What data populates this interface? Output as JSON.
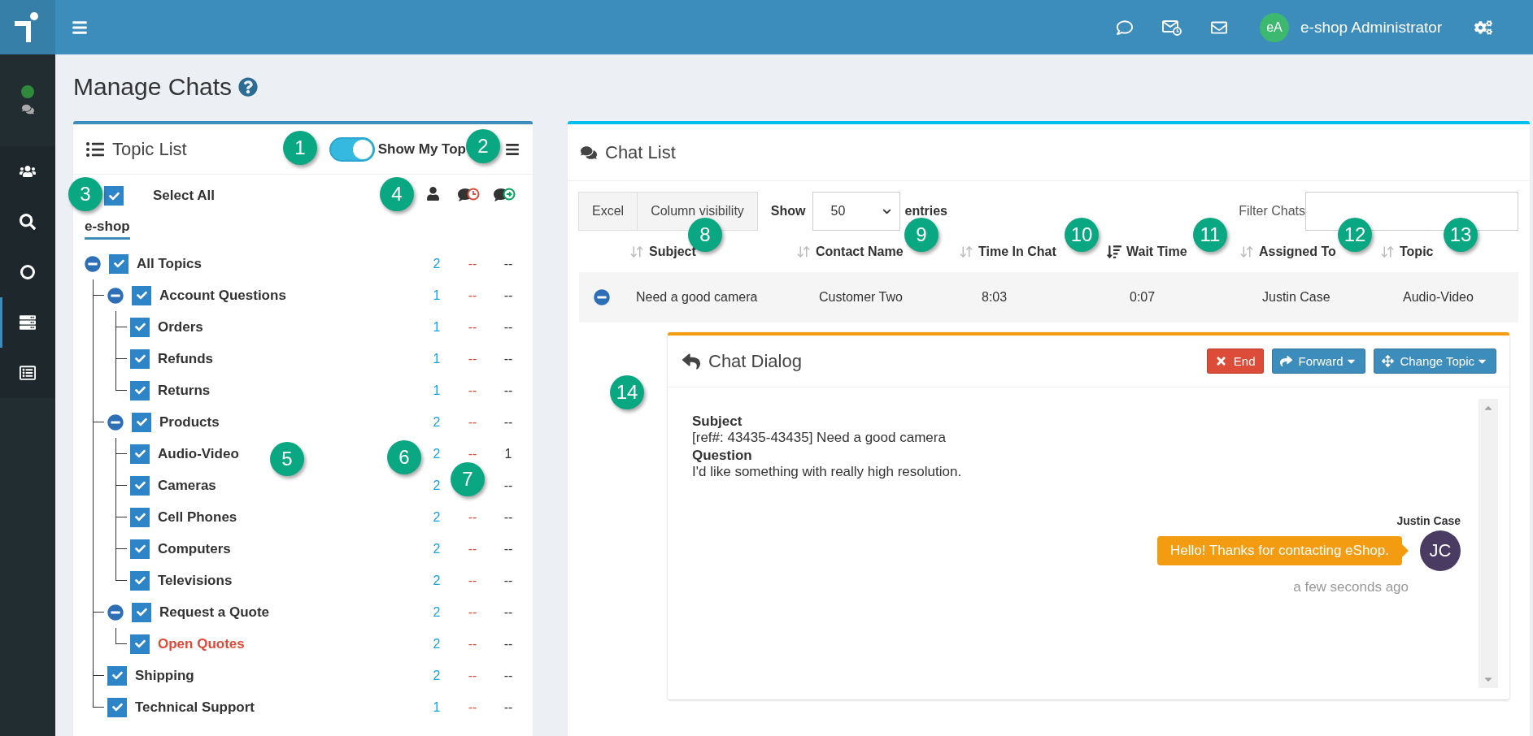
{
  "top_bar": {
    "user_initials": "eA",
    "user_name": "e-shop Administrator"
  },
  "sidebar": {
    "items": [
      {
        "kind": "users",
        "selected": false
      },
      {
        "kind": "search",
        "selected": false
      },
      {
        "kind": "circle",
        "selected": false
      },
      {
        "kind": "server",
        "selected": true
      },
      {
        "kind": "list",
        "selected": false
      }
    ]
  },
  "page_title": "Manage Chats",
  "topic_list": {
    "title": "Topic List",
    "toggle": {
      "label": "Show My Top",
      "on": true
    },
    "select_all": {
      "label": "Select All",
      "checked": true
    },
    "tabs": [
      {
        "label": "e-shop",
        "selected": true
      }
    ],
    "tree": [
      {
        "label": "All Topics",
        "checked": true,
        "expanded": true,
        "highlighted": false,
        "count": "2",
        "waiting": "--",
        "active": "--",
        "children": [
          {
            "label": "Account Questions",
            "checked": true,
            "expanded": true,
            "highlighted": false,
            "count": "1",
            "waiting": "--",
            "active": "--",
            "children": [
              {
                "label": "Orders",
                "checked": true,
                "highlighted": false,
                "count": "1",
                "waiting": "--",
                "active": "--"
              },
              {
                "label": "Refunds",
                "checked": true,
                "highlighted": false,
                "count": "1",
                "waiting": "--",
                "active": "--"
              },
              {
                "label": "Returns",
                "checked": true,
                "highlighted": false,
                "count": "1",
                "waiting": "--",
                "active": "--"
              }
            ]
          },
          {
            "label": "Products",
            "checked": true,
            "expanded": true,
            "highlighted": false,
            "count": "2",
            "waiting": "--",
            "active": "--",
            "children": [
              {
                "label": "Audio-Video",
                "checked": true,
                "highlighted": false,
                "count": "2",
                "waiting": "--",
                "active": "1"
              },
              {
                "label": "Cameras",
                "checked": true,
                "highlighted": false,
                "count": "2",
                "active": "--"
              },
              {
                "label": "Cell Phones",
                "checked": true,
                "highlighted": false,
                "count": "2",
                "waiting": "--",
                "active": "--"
              },
              {
                "label": "Computers",
                "checked": true,
                "highlighted": false,
                "count": "2",
                "waiting": "--",
                "active": "--"
              },
              {
                "label": "Televisions",
                "checked": true,
                "highlighted": false,
                "count": "2",
                "waiting": "--",
                "active": "--"
              }
            ]
          },
          {
            "label": "Request a Quote",
            "checked": true,
            "expanded": true,
            "highlighted": false,
            "count": "2",
            "waiting": "--",
            "active": "--",
            "children": [
              {
                "label": "Open Quotes",
                "checked": true,
                "highlighted": true,
                "count": "2",
                "waiting": "--",
                "active": "--"
              }
            ]
          },
          {
            "label": "Shipping",
            "checked": true,
            "highlighted": false,
            "count": "2",
            "waiting": "--",
            "active": "--"
          },
          {
            "label": "Technical Support",
            "checked": true,
            "highlighted": false,
            "count": "1",
            "waiting": "--",
            "active": "--"
          }
        ]
      }
    ]
  },
  "chat_list": {
    "title": "Chat List",
    "buttons": [
      "Excel",
      "Column visibility"
    ],
    "length": {
      "label_before": "Show",
      "value": "50",
      "label_after": "entries"
    },
    "filter": {
      "label": "Filter Chats"
    },
    "columns": [
      {
        "label": "Subject",
        "sorted": false
      },
      {
        "label": "Contact Name",
        "sorted": false
      },
      {
        "label": "Time In Chat",
        "sorted": false
      },
      {
        "label": "Wait Time",
        "sorted": true
      },
      {
        "label": "Assigned To",
        "sorted": false
      },
      {
        "label": "Topic",
        "sorted": false
      }
    ],
    "rows": [
      {
        "expanded": true,
        "cells": [
          "Need a good camera",
          "Customer Two",
          "8:03",
          "0:07",
          "Justin Case",
          "Audio-Video"
        ]
      }
    ]
  },
  "chat_dialog": {
    "title": "Chat Dialog",
    "actions": [
      {
        "label": "End",
        "kind": "end"
      },
      {
        "label": "Forward",
        "kind": "forward"
      },
      {
        "label": "Change Topic",
        "kind": "move"
      }
    ],
    "fields": [
      {
        "label": "Subject",
        "value": "[ref#: 43435-43435] Need a good camera"
      },
      {
        "label": "Question",
        "value": "I'd like something with really high resolution."
      }
    ],
    "messages": [
      {
        "sender": "Justin Case",
        "initials": "JC",
        "text": "Hello! Thanks for contacting eShop.",
        "time": "a few seconds ago"
      }
    ]
  },
  "callouts": [
    "1",
    "2",
    "3",
    "4",
    "5",
    "6",
    "7",
    "8",
    "9",
    "10",
    "11",
    "12",
    "13",
    "14"
  ]
}
